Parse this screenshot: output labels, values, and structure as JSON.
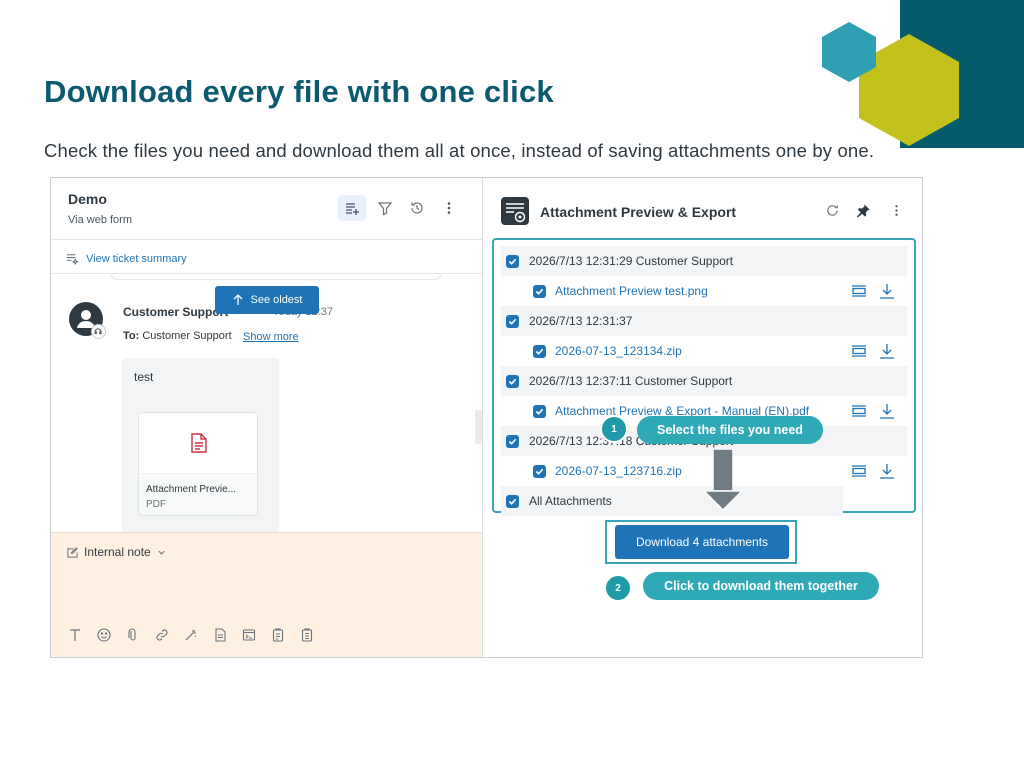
{
  "slide": {
    "title": "Download every file with one click",
    "subtitle": "Check the files you need and download them all at once, instead of saving attachments one by one."
  },
  "colors": {
    "brand_teal": "#055a6c",
    "accent_teal": "#36a5b8",
    "accent_lime": "#c3c11c",
    "link_blue": "#1f73b7",
    "composer_bg": "#fff1e2"
  },
  "ticket": {
    "name": "Demo",
    "channel": "Via web form",
    "toolbar_icons": [
      "list-icon",
      "filter-icon",
      "history-icon",
      "more-icon"
    ],
    "summary_link": "View ticket summary",
    "see_oldest": "See oldest",
    "message": {
      "author": "Customer Support",
      "time": "Today 12:37",
      "to_label": "To:",
      "to_value": "Customer Support",
      "show_more": "Show more",
      "body": "test",
      "attachment_name": "Attachment Previe...",
      "attachment_type": "PDF"
    },
    "composer": {
      "mode": "Internal note",
      "tools": [
        "text-format-icon",
        "emoji-icon",
        "attach-icon",
        "link-icon",
        "magic-icon",
        "doc-icon",
        "terminal-icon",
        "clipboard-icon",
        "clipboard-list-icon"
      ]
    }
  },
  "app": {
    "title": "Attachment Preview & Export",
    "header_icons": [
      "refresh-icon",
      "pin-icon",
      "more-icon"
    ],
    "groups": [
      {
        "label": "2026/7/13 12:31:29 Customer Support",
        "file": "Attachment Preview test.png"
      },
      {
        "label": "2026/7/13 12:31:37",
        "file": "2026-07-13_123134.zip"
      },
      {
        "label": "2026/7/13 12:37:11 Customer Support",
        "file": "Attachment Preview & Export - Manual (EN).pdf"
      },
      {
        "label": "2026/7/13 12:37:18 Customer Support",
        "file": "2026-07-13_123716.zip"
      }
    ],
    "all_label": "All Attachments",
    "download_button": "Download 4 attachments"
  },
  "callouts": {
    "step1_num": "1",
    "step1_text": "Select the files you need",
    "step2_num": "2",
    "step2_text": "Click to download them together"
  }
}
